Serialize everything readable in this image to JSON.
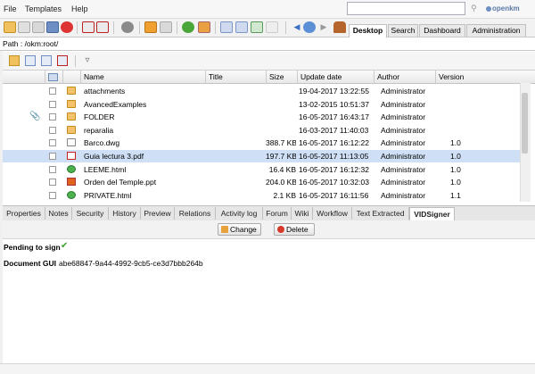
{
  "menu": {
    "items": [
      "File",
      "Templates",
      "Help"
    ]
  },
  "search": {
    "placeholder": ""
  },
  "logo": {
    "text": "openkm"
  },
  "workspace_tabs": [
    "Desktop",
    "Search",
    "Dashboard",
    "Administration"
  ],
  "path": {
    "text": "Path : /okm:root/"
  },
  "table": {
    "headers": [
      "Name",
      "Title",
      "Size",
      "Update date",
      "Author",
      "Version"
    ],
    "rows": [
      {
        "icon": "folder-icon",
        "name": "attachments",
        "title": "",
        "size": "",
        "date": "19-04-2017 13:22:55",
        "author": "Administrator",
        "version": "",
        "selected": false,
        "attachment": false
      },
      {
        "icon": "folder-icon",
        "name": "AvancedExamples",
        "title": "",
        "size": "",
        "date": "13-02-2015 10:51:37",
        "author": "Administrator",
        "version": "",
        "selected": false,
        "attachment": false
      },
      {
        "icon": "folder-icon",
        "name": "FOLDER",
        "title": "",
        "size": "",
        "date": "16-05-2017 16:43:17",
        "author": "Administrator",
        "version": "",
        "selected": false,
        "attachment": true
      },
      {
        "icon": "folder-icon",
        "name": "reparalia",
        "title": "",
        "size": "",
        "date": "16-03-2017 11:40:03",
        "author": "Administrator",
        "version": "",
        "selected": false,
        "attachment": false
      },
      {
        "icon": "dwg-icon",
        "name": "Barco.dwg",
        "title": "",
        "size": "388.7 KB",
        "date": "16-05-2017 16:12:22",
        "author": "Administrator",
        "version": "1.0",
        "selected": false,
        "attachment": false
      },
      {
        "icon": "pdf-icon",
        "name": "Guia lectura 3.pdf",
        "title": "",
        "size": "197.7 KB",
        "date": "16-05-2017 11:13:05",
        "author": "Administrator",
        "version": "1.0",
        "selected": true,
        "attachment": false
      },
      {
        "icon": "html-icon",
        "name": "LEEME.html",
        "title": "",
        "size": "16.4 KB",
        "date": "16-05-2017 16:12:32",
        "author": "Administrator",
        "version": "1.0",
        "selected": false,
        "attachment": false
      },
      {
        "icon": "ppt-icon",
        "name": "Orden del Temple.ppt",
        "title": "",
        "size": "204.0 KB",
        "date": "16-05-2017 10:32:03",
        "author": "Administrator",
        "version": "1.0",
        "selected": false,
        "attachment": false
      },
      {
        "icon": "html-icon",
        "name": "PRIVATE.html",
        "title": "",
        "size": "2.1 KB",
        "date": "16-05-2017 16:11:56",
        "author": "Administrator",
        "version": "1.1",
        "selected": false,
        "attachment": false
      }
    ]
  },
  "properties_tabs": [
    "Properties",
    "Notes",
    "Security",
    "History",
    "Preview",
    "Relations",
    "Activity log",
    "Forum",
    "Wiki",
    "Workflow",
    "Text Extracted",
    "VIDSigner"
  ],
  "active_properties_tab": "VIDSigner",
  "actions": {
    "change_label": "Change",
    "delete_label": "Delete"
  },
  "signer": {
    "pending_label": "Pending to sign",
    "doc_label": "Document GUI",
    "doc_value": "abe68847-9a44-4992-9cb5-ce3d7bbb264b"
  }
}
